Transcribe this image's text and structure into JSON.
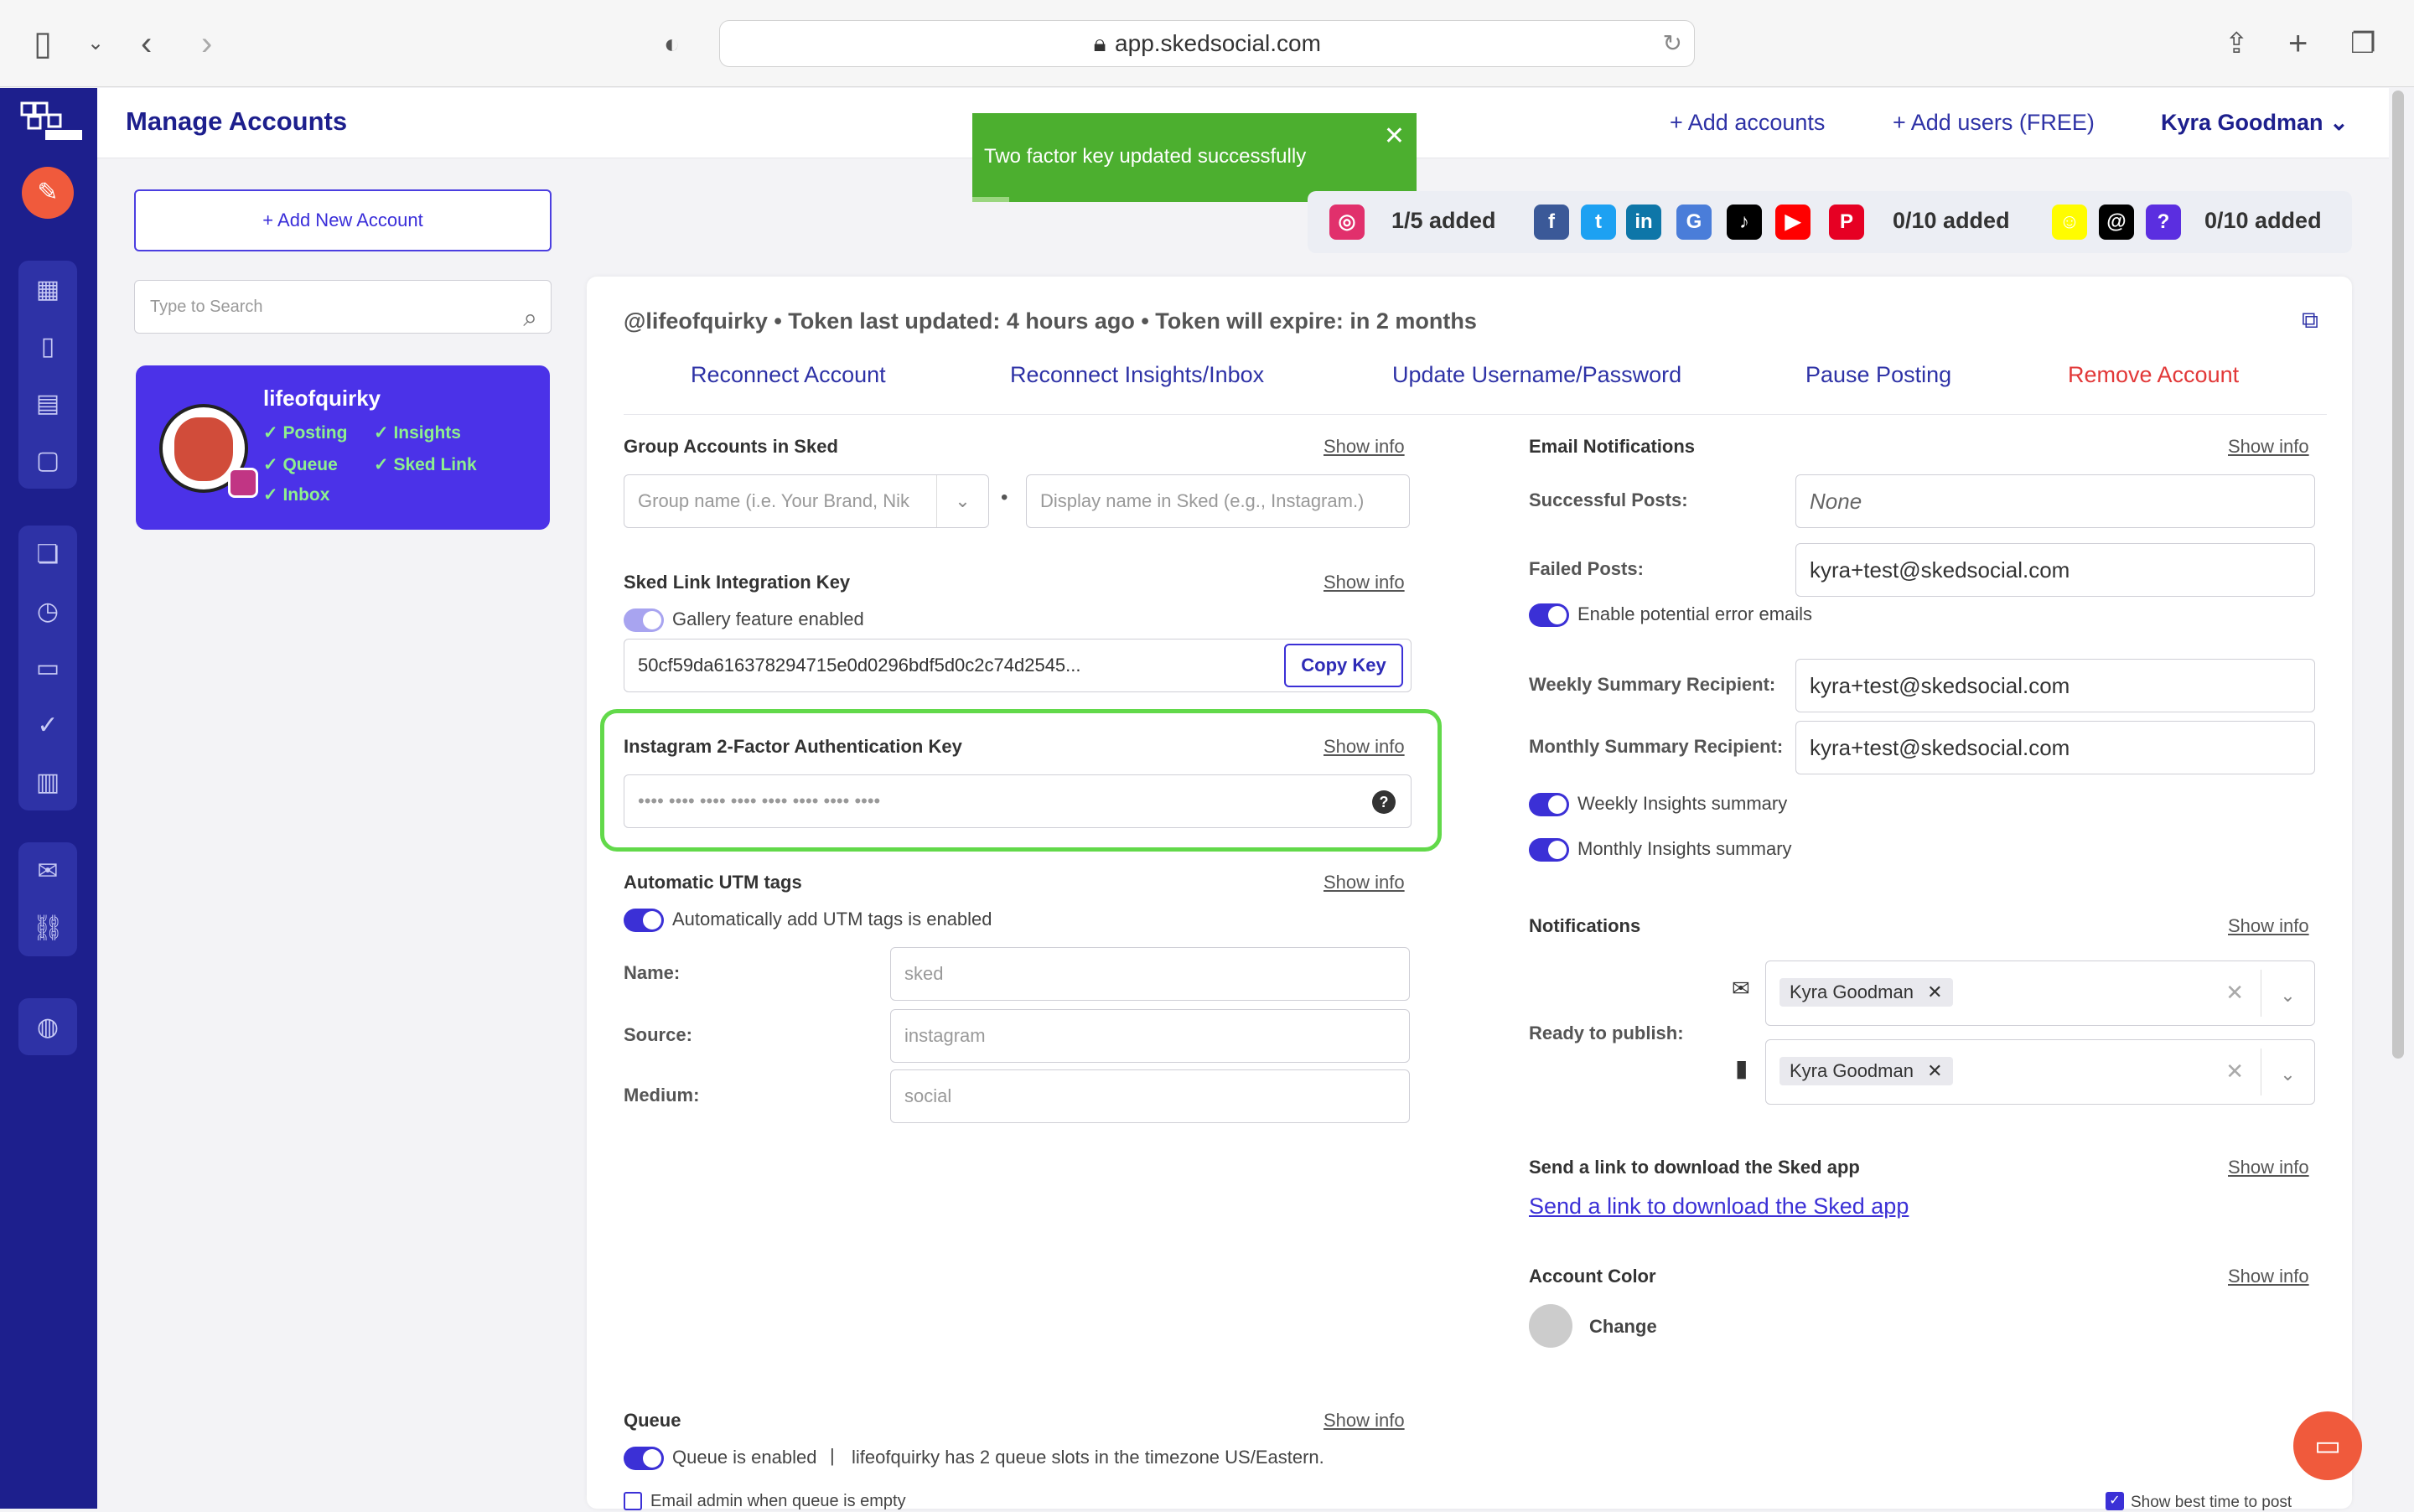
{
  "browser": {
    "url": "app.skedsocial.com"
  },
  "header": {
    "title": "Manage Accounts",
    "add_accounts": "+  Add accounts",
    "add_users": "+  Add users (FREE)",
    "user_name": "Kyra Goodman"
  },
  "toast": {
    "message": "Two factor key updated successfully",
    "close": "✕"
  },
  "left": {
    "add_account": "+ Add New Account",
    "search_placeholder": "Type to Search",
    "account": {
      "name": "lifeofquirky",
      "tags": [
        "Posting",
        "Insights",
        "Queue",
        "Sked Link",
        "Inbox"
      ]
    }
  },
  "social_strip": {
    "instagram_count": "1/5 added",
    "group2_count": "0/10 added",
    "group3_count": "0/10 added",
    "icons": [
      "instagram-icon",
      "facebook-icon",
      "twitter-icon",
      "linkedin-icon",
      "google-business-icon",
      "tiktok-icon",
      "youtube-icon",
      "pinterest-icon",
      "snapchat-icon",
      "threads-icon",
      "other-platform-icon"
    ]
  },
  "panel": {
    "header": "@lifeofquirky  •  Token last updated: 4 hours ago  •  Token will expire: in 2 months",
    "actions": {
      "reconnect": "Reconnect Account",
      "reconnect_insights": "Reconnect Insights/Inbox",
      "update_credentials": "Update Username/Password",
      "pause": "Pause Posting",
      "remove": "Remove Account"
    },
    "show_info": "Show info",
    "group": {
      "label": "Group Accounts in Sked",
      "group_placeholder": "Group name (i.e. Your Brand, Nik",
      "display_placeholder": "Display name in Sked (e.g., Instagram.)"
    },
    "sked_link": {
      "label": "Sked Link Integration Key",
      "toggle_label": "Gallery feature enabled",
      "key": "50cf59da616378294715e0d0296bdf5d0c2c74d2545...",
      "copy": "Copy Key"
    },
    "two_factor": {
      "label": "Instagram 2-Factor Authentication Key",
      "placeholder": "•••• •••• •••• •••• •••• •••• •••• ••••",
      "help": "?"
    },
    "utm": {
      "label": "Automatic UTM tags",
      "toggle_label": "Automatically add UTM tags is enabled",
      "name_label": "Name:",
      "name_placeholder": "sked",
      "source_label": "Source:",
      "source_placeholder": "instagram",
      "medium_label": "Medium:",
      "medium_placeholder": "social"
    },
    "queue": {
      "label": "Queue",
      "toggle_label": "Queue is enabled",
      "info": "lifeofquirky has 2 queue slots in the timezone US/Eastern.",
      "email_admin": "Email admin when queue is empty",
      "best_time": "Show best time to post"
    },
    "email": {
      "label": "Email Notifications",
      "successful_label": "Successful Posts:",
      "successful_value": "None",
      "failed_label": "Failed Posts:",
      "failed_value": "kyra+test@skedsocial.com",
      "error_toggle": "Enable potential error emails",
      "weekly_label": "Weekly Summary Recipient:",
      "weekly_value": "kyra+test@skedsocial.com",
      "monthly_label": "Monthly Summary Recipient:",
      "monthly_value": "kyra+test@skedsocial.com",
      "weekly_insights": "Weekly Insights summary",
      "monthly_insights": "Monthly Insights summary"
    },
    "notifications": {
      "label": "Notifications",
      "ready_label": "Ready to publish:",
      "chip1": "Kyra Goodman",
      "chip2": "Kyra Goodman"
    },
    "download": {
      "label": "Send a link to download the Sked app",
      "link": "Send a link to download the Sked app"
    },
    "color": {
      "label": "Account Color",
      "change": "Change"
    }
  }
}
